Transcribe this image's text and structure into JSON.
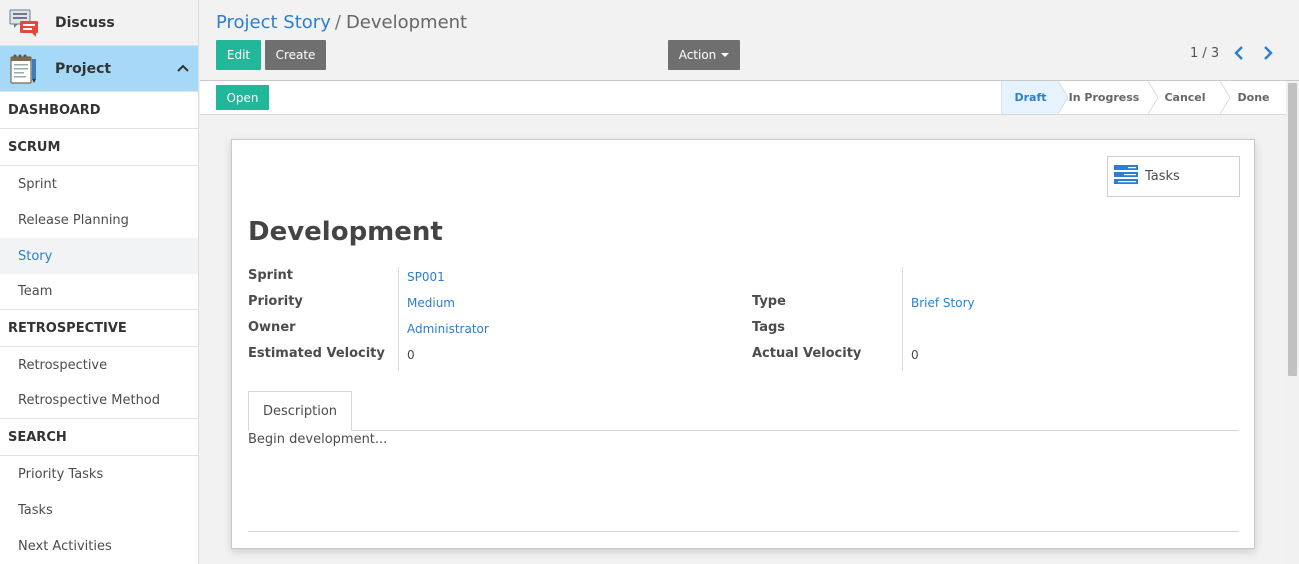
{
  "sidebar": {
    "apps": [
      {
        "label": "Discuss",
        "icon": "chat-bubbles-icon"
      },
      {
        "label": "Project",
        "icon": "project-notepad-icon"
      }
    ],
    "sections": {
      "dashboard": "DASHBOARD",
      "scrum": "SCRUM",
      "retrospective": "RETROSPECTIVE",
      "search": "SEARCH"
    },
    "items": {
      "sprint": "Sprint",
      "release_planning": "Release Planning",
      "story": "Story",
      "team": "Team",
      "retrospective": "Retrospective",
      "retrospective_method": "Retrospective Method",
      "priority_tasks": "Priority Tasks",
      "tasks": "Tasks",
      "next_activities": "Next Activities"
    }
  },
  "breadcrumb": {
    "parent": "Project Story",
    "separator": "/",
    "current": "Development"
  },
  "toolbar": {
    "edit": "Edit",
    "create": "Create",
    "action": "Action"
  },
  "pager": {
    "value": "1 / 3",
    "prev_icon": "chevron-left-icon",
    "next_icon": "chevron-right-icon"
  },
  "statusbar": {
    "open": "Open",
    "stages": [
      "Draft",
      "In Progress",
      "Cancel",
      "Done"
    ],
    "active_stage": "Draft"
  },
  "form": {
    "smart_button": "Tasks",
    "title": "Development",
    "left": {
      "sprint_label": "Sprint",
      "sprint_value": "SP001",
      "priority_label": "Priority",
      "priority_value": "Medium",
      "owner_label": "Owner",
      "owner_value": "Administrator",
      "est_velocity_label": "Estimated Velocity",
      "est_velocity_value": "0"
    },
    "right": {
      "type_label": "Type",
      "type_value": "Brief Story",
      "tags_label": "Tags",
      "tags_value": "",
      "act_velocity_label": "Actual Velocity",
      "act_velocity_value": "0"
    },
    "tab": "Description",
    "description": "Begin development..."
  },
  "colors": {
    "primary": "#21b799",
    "secondary": "#6f6f6f",
    "link": "#2b7ed0",
    "active_app": "#a6d9f7"
  }
}
